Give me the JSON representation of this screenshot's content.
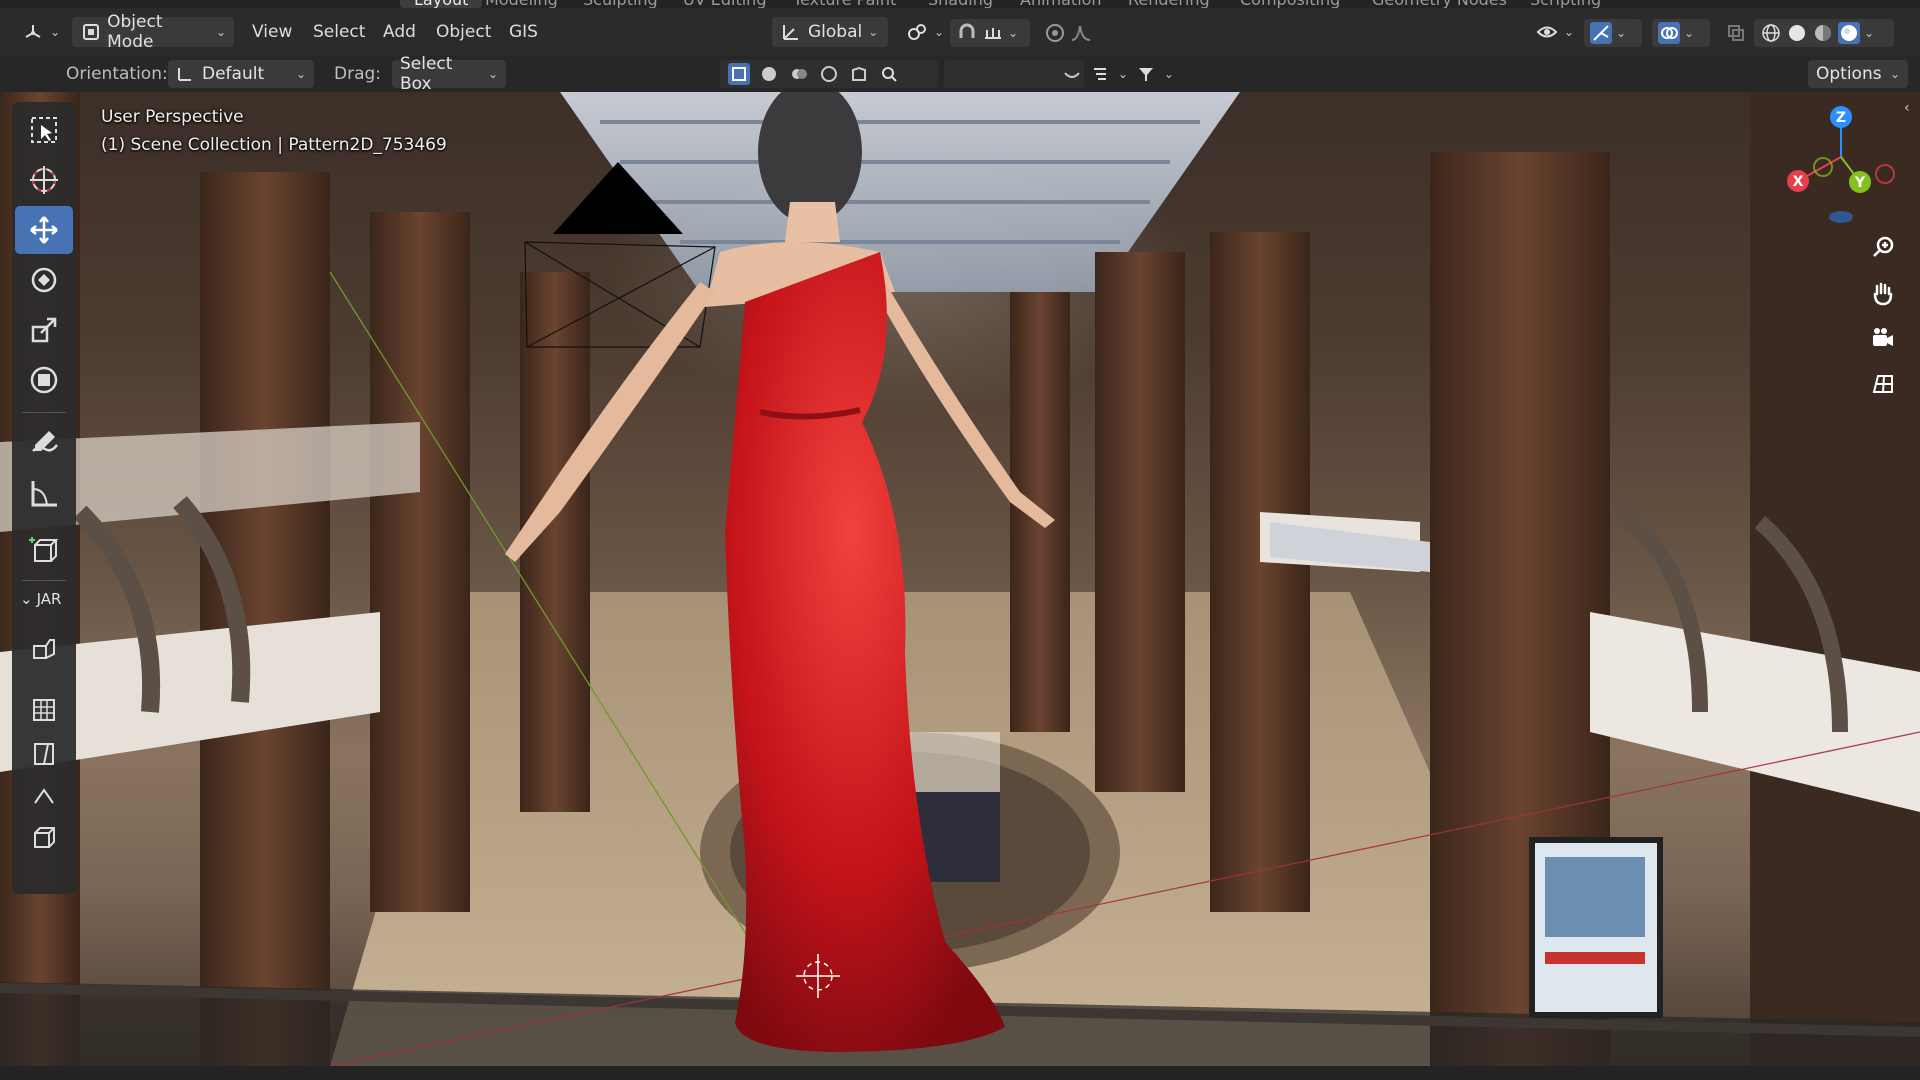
{
  "workspace_tabs": [
    {
      "label": "Layout",
      "active": true
    },
    {
      "label": "Modeling"
    },
    {
      "label": "Sculpting"
    },
    {
      "label": "UV Editing"
    },
    {
      "label": "Texture Paint"
    },
    {
      "label": "Shading"
    },
    {
      "label": "Animation"
    },
    {
      "label": "Rendering"
    },
    {
      "label": "Compositing"
    },
    {
      "label": "Geometry Nodes"
    },
    {
      "label": "Scripting"
    }
  ],
  "header": {
    "editor_type_icon": "viewport-icon",
    "mode": "Object Mode",
    "menus": [
      "View",
      "Select",
      "Add",
      "Object",
      "GIS"
    ],
    "transform_orientation": "Global",
    "icons": [
      "pivot-icon",
      "snap-icon",
      "snap-increment-icon",
      "proportional-edit-icon",
      "falloff-icon",
      "visibility-icon",
      "gizmo-icon",
      "overlay-icon",
      "xray-icon",
      "wireframe-shading-icon",
      "solid-shading-icon",
      "material-shading-icon",
      "rendered-shading-icon"
    ]
  },
  "tool_settings": {
    "orientation_label": "Orientation:",
    "orientation_value": "Default",
    "drag_label": "Drag:",
    "drag_value": "Select Box",
    "options_label": "Options"
  },
  "viewport": {
    "view_name": "User Perspective",
    "collection_info": "(1) Scene Collection | Pattern2D_753469",
    "accent": "#4772b3"
  },
  "toolbar": {
    "tools": [
      {
        "name": "select-box-tool",
        "icon": "select-box-icon",
        "active": false
      },
      {
        "name": "cursor-tool",
        "icon": "cursor-icon",
        "active": false
      },
      {
        "name": "move-tool",
        "icon": "move-icon",
        "active": true
      },
      {
        "name": "rotate-tool",
        "icon": "rotate-icon",
        "active": false
      },
      {
        "name": "scale-tool",
        "icon": "scale-icon",
        "active": false
      },
      {
        "name": "transform-tool",
        "icon": "transform-icon",
        "active": false
      },
      {
        "name": "annotate-tool",
        "icon": "annotate-icon",
        "active": false
      },
      {
        "name": "measure-tool",
        "icon": "measure-icon",
        "active": false
      },
      {
        "name": "add-cube-tool",
        "icon": "add-cube-icon",
        "active": false
      }
    ],
    "section_label": "JAR",
    "extra_tools": [
      "jar-tool-icon",
      "grid-icon",
      "panel-icon",
      "curve-icon",
      "box-icon"
    ]
  },
  "gizmo": {
    "axis_x": "X",
    "axis_y": "Y",
    "axis_z": "Z",
    "colors": {
      "x": "#e4404e",
      "y": "#84c11c",
      "z": "#2c8fff"
    }
  },
  "nav_buttons": [
    "zoom-icon",
    "pan-hand-icon",
    "camera-view-icon",
    "ortho-grid-icon"
  ]
}
